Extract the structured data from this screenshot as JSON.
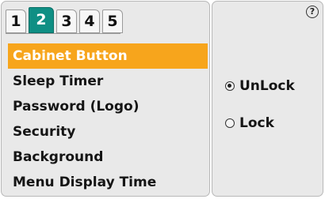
{
  "tabs": [
    {
      "label": "1",
      "active": false
    },
    {
      "label": "2",
      "active": true
    },
    {
      "label": "3",
      "active": false
    },
    {
      "label": "4",
      "active": false
    },
    {
      "label": "5",
      "active": false
    }
  ],
  "menu": {
    "items": [
      {
        "label": "Cabinet Button",
        "selected": true
      },
      {
        "label": "Sleep Timer",
        "selected": false
      },
      {
        "label": "Password (Logo)",
        "selected": false
      },
      {
        "label": "Security",
        "selected": false
      },
      {
        "label": "Background",
        "selected": false
      },
      {
        "label": "Menu Display Time",
        "selected": false
      }
    ]
  },
  "options_panel": {
    "help_icon": "question-circle-icon",
    "help_glyph": "?",
    "options": [
      {
        "label": "UnLock",
        "checked": true
      },
      {
        "label": "Lock",
        "checked": false
      }
    ]
  },
  "colors": {
    "active_tab": "#0f8f84",
    "selected_item": "#f7a51c",
    "panel_bg": "#e9e9e9"
  }
}
